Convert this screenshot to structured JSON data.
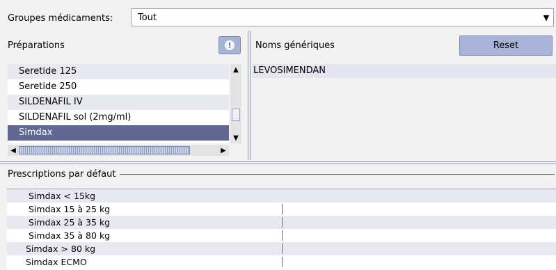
{
  "group": {
    "label": "Groupes médicaments:",
    "value": "Tout"
  },
  "preparations": {
    "label": "Préparations",
    "items": [
      {
        "label": "Seretide 125"
      },
      {
        "label": "Seretide 250"
      },
      {
        "label": "SILDENAFIL IV"
      },
      {
        "label": "SILDENAFIL sol (2mg/ml)"
      },
      {
        "label": "Simdax",
        "selected": true
      }
    ]
  },
  "generics": {
    "label": "Noms génériques",
    "reset_label": "Reset",
    "items": [
      "LEVOSIMENDAN"
    ]
  },
  "prescriptions": {
    "label": "Prescriptions par défaut",
    "rows": [
      "Simdax < 15kg",
      "Simdax 15 à 25 kg",
      "Simdax 25 à 35 kg",
      "Simdax 35 à 80 kg",
      "Simdax > 80 kg",
      "Simdax ECMO"
    ]
  },
  "colors": {
    "selection": "#5e6893",
    "button": "#a9b3d8",
    "alt_row": "#e7e8f0"
  },
  "icons": {
    "info": "exclamation-icon"
  }
}
